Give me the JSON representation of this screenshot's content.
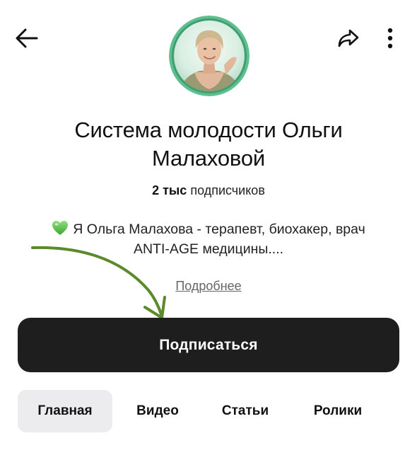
{
  "header": {
    "back_icon": "arrow-left-icon",
    "share_icon": "share-icon",
    "more_icon": "more-vertical-icon"
  },
  "channel": {
    "title_line1": "Система молодости Ольги",
    "title_line2": "Малаховой",
    "subscribers_count": "2 тыс",
    "subscribers_label": "подписчиков",
    "description_line1": "Я Ольга Малахова - терапевт, биохакер, врач",
    "description_line2": "ANTI-AGE медицины....",
    "description_emoji": "green-heart-icon",
    "more_link": "Подробнее"
  },
  "subscribe_button": {
    "label": "Подписаться"
  },
  "tabs": [
    {
      "label": "Главная",
      "active": true
    },
    {
      "label": "Видео",
      "active": false
    },
    {
      "label": "Статьи",
      "active": false
    },
    {
      "label": "Ролики",
      "active": false
    }
  ],
  "colors": {
    "button_bg": "#1f1e1f",
    "active_tab_bg": "#ececee",
    "annotation_arrow": "#5a8a2a",
    "avatar_ring": "#5fbf8f"
  }
}
